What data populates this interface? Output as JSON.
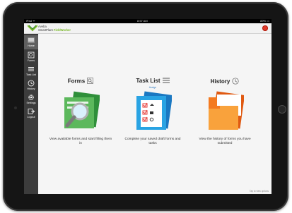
{
  "status_bar": {
    "carrier": "iPad ᯤ",
    "time": "8:57 AM",
    "battery": "89% ▭"
  },
  "header": {
    "brand_line1": "Aveba",
    "brand_line2_prefix": "SmartPlant ",
    "brand_line2_suffix": "FieldWorker"
  },
  "sidebar": {
    "items": [
      {
        "label": "Home",
        "icon": "home-icon"
      },
      {
        "label": "Forms",
        "icon": "forms-icon"
      },
      {
        "label": "Task List",
        "icon": "task-list-icon"
      },
      {
        "label": "History",
        "icon": "history-icon"
      },
      {
        "label": "Settings",
        "icon": "gear-icon"
      },
      {
        "label": "Logout",
        "icon": "logout-icon"
      }
    ]
  },
  "tiles": [
    {
      "title": "Forms",
      "icon": "magnifier-icon",
      "description": "View available forms and start filling them in"
    },
    {
      "title": "Task List",
      "icon": "list-icon",
      "link": "Assign",
      "description": "Complete your saved draft forms and tasks"
    },
    {
      "title": "History",
      "icon": "clock-icon",
      "description": "View the history of forms you have submitted"
    }
  ],
  "footer": {
    "note": "Tap to view options"
  },
  "colors": {
    "sidebar": "#3c3c3c",
    "accent_green": "#7ab928",
    "forms_green": "#4caf50",
    "tasks_blue": "#29a3e3",
    "history_orange": "#f47a20",
    "power_red": "#e03a2c"
  }
}
